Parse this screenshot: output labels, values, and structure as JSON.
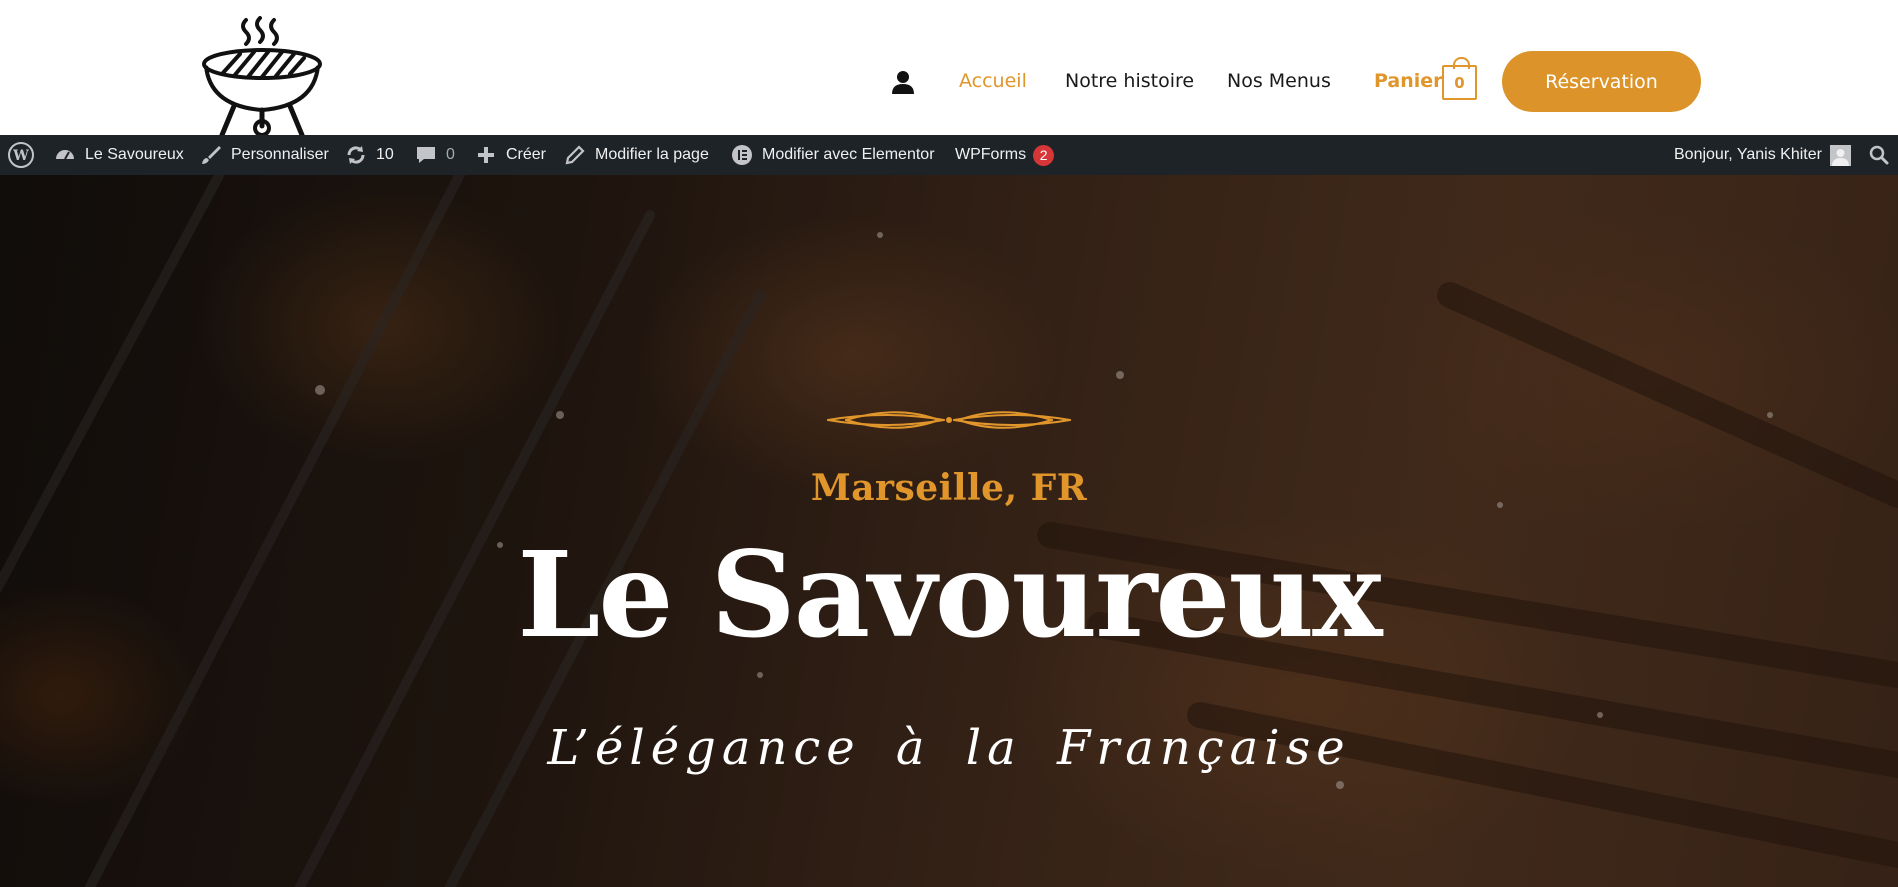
{
  "header": {
    "logo_name": "grill-logo",
    "nav": {
      "user_icon": "user-icon",
      "items": [
        {
          "label": "Accueil",
          "active": true
        },
        {
          "label": "Notre histoire",
          "active": false
        },
        {
          "label": "Nos Menus",
          "active": false
        }
      ],
      "cart_label": "Panier",
      "cart_count": "0",
      "reservation_label": "Réservation"
    },
    "colors": {
      "accent": "#dc942a",
      "text": "#1a1a1a"
    }
  },
  "adminbar": {
    "wp_icon": "wordpress-icon",
    "site_name": "Le Savoureux",
    "customize": "Personnaliser",
    "updates_count": "10",
    "comments_count": "0",
    "create": "Créer",
    "edit_page": "Modifier la page",
    "elementor": "Modifier avec Elementor",
    "wpforms": "WPForms",
    "wpforms_badge": "2",
    "greeting": "Bonjour, Yanis Khiter",
    "search_icon": "search-icon",
    "colors": {
      "background": "#1d2327",
      "badge": "#d63638"
    }
  },
  "hero": {
    "city": "Marseille, FR",
    "title": "Le Savoureux",
    "tagline": "L’élégance à la Française"
  }
}
